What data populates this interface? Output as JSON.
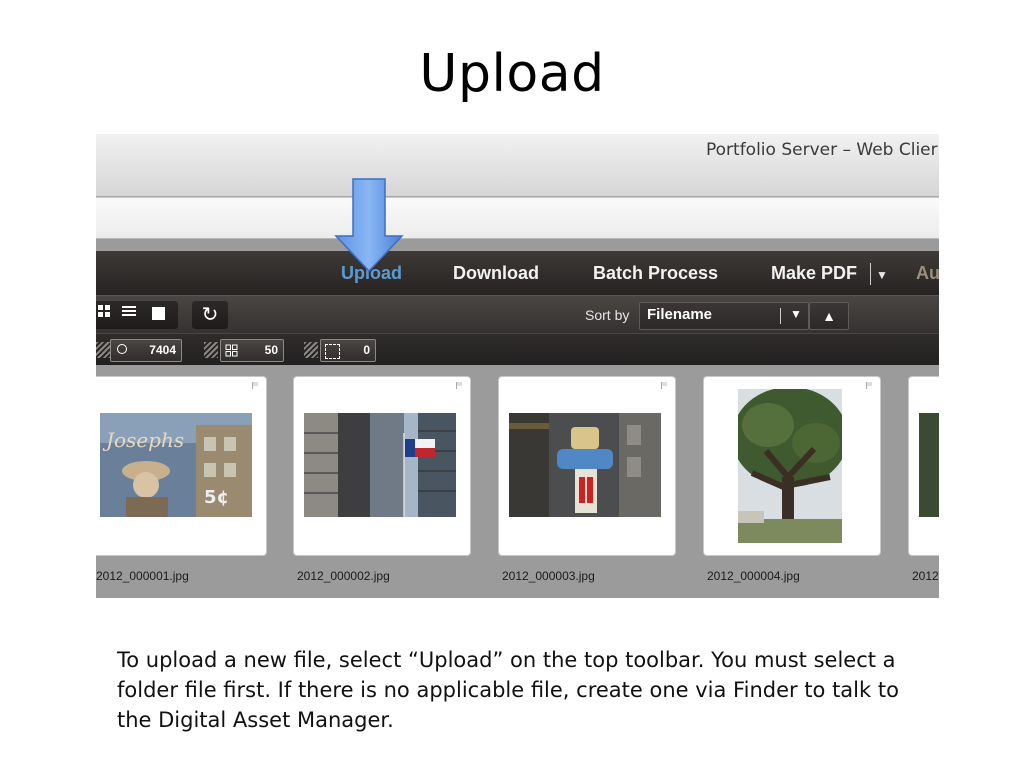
{
  "slide": {
    "title": "Upload",
    "caption": "To upload a new file, select “Upload” on the top toolbar. You must select a folder file first. If there is no applicable file, create one via Finder to talk to the Digital Asset Manager."
  },
  "window": {
    "title": "Portfolio Server – Web Clier"
  },
  "toolbar": {
    "upload": "Upload",
    "download": "Download",
    "batch": "Batch Process",
    "make_pdf": "Make PDF",
    "more": "Au"
  },
  "sort": {
    "label": "Sort by",
    "value": "Filename"
  },
  "counts": {
    "found": "7404",
    "selected_grid": "50",
    "selected": "0"
  },
  "files": [
    "2012_000001.jpg",
    "2012_000002.jpg",
    "2012_000003.jpg",
    "2012_000004.jpg",
    "2012"
  ],
  "colors": {
    "accent": "#5b9bd5",
    "toolbar_bg": "#2e2a29",
    "gallery_bg": "#9b9b9b"
  },
  "icons": [
    "grid-view-icon",
    "list-view-icon",
    "single-view-icon",
    "refresh-icon",
    "magnifier-icon",
    "flag-icon",
    "down-arrow-icon"
  ]
}
